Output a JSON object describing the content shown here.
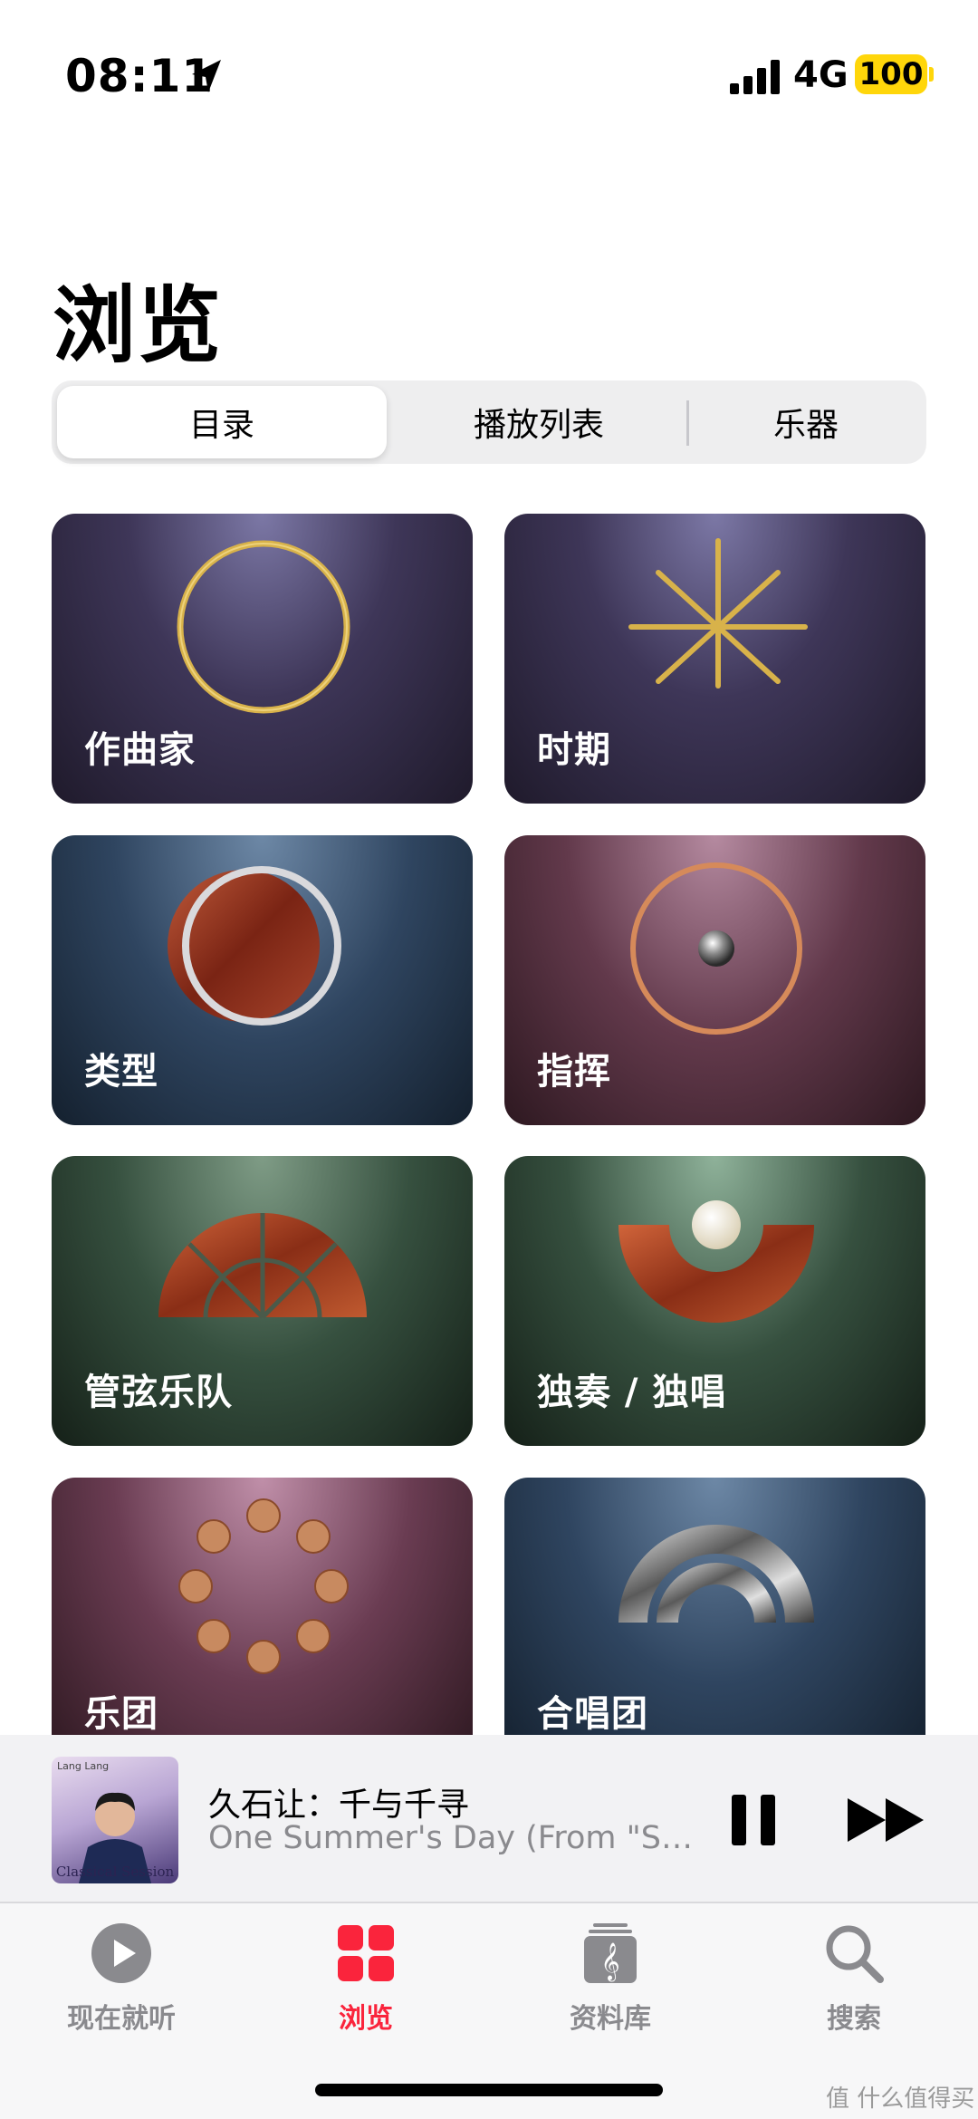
{
  "status_bar": {
    "time": "08:11",
    "network": "4G",
    "battery": "100",
    "battery_color": "#ffd60a",
    "icons": [
      "location-arrow-icon",
      "signal-bars-icon"
    ]
  },
  "page": {
    "title": "浏览"
  },
  "segmented_control": {
    "selected": 0,
    "segments": [
      {
        "label": "目录"
      },
      {
        "label": "播放列表"
      },
      {
        "label": "乐器"
      }
    ]
  },
  "categories": [
    {
      "label": "作曲家",
      "icon": "gold-ring-icon"
    },
    {
      "label": "时期",
      "icon": "gold-starburst-icon"
    },
    {
      "label": "类型",
      "icon": "wood-disc-ring-icon"
    },
    {
      "label": "指挥",
      "icon": "copper-ring-pearl-icon"
    },
    {
      "label": "管弦乐队",
      "icon": "wood-fan-icon"
    },
    {
      "label": "独奏 / 独唱",
      "icon": "wood-arc-pearl-icon"
    },
    {
      "label": "乐团",
      "icon": "wood-dots-circle-icon"
    },
    {
      "label": "合唱团",
      "icon": "chrome-dome-icon"
    }
  ],
  "mini_player": {
    "album_artist": "Lang Lang",
    "album_series": "Classical Session",
    "title": "久石让：千与千寻",
    "subtitle": "One Summer's Day (From \"Spiri...",
    "controls": [
      "pause-icon",
      "fast-forward-icon"
    ]
  },
  "tab_bar": {
    "active": 1,
    "accent_color": "#fa243c",
    "tabs": [
      {
        "label": "现在就听",
        "icon": "play-circle-icon"
      },
      {
        "label": "浏览",
        "icon": "grid-icon"
      },
      {
        "label": "资料库",
        "icon": "library-icon"
      },
      {
        "label": "搜索",
        "icon": "search-icon"
      }
    ]
  },
  "watermark": "值 什么值得买"
}
